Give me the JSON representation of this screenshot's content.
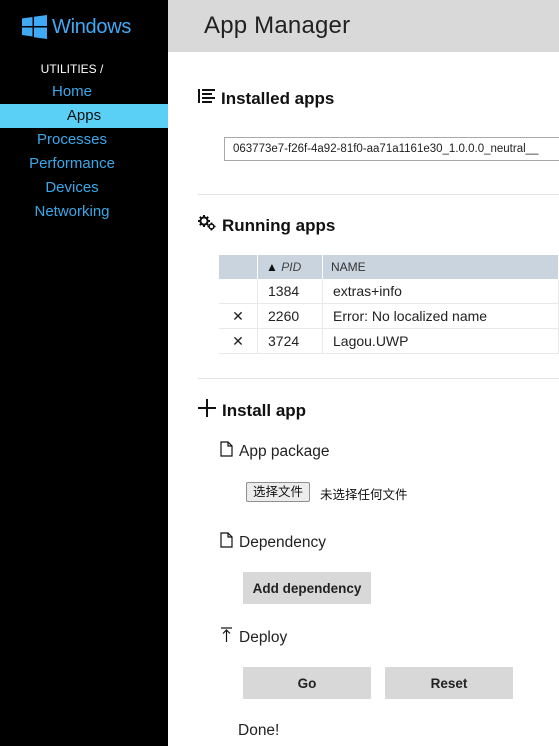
{
  "brand": {
    "logo_text": "Windows",
    "accent": "#3fa9f5"
  },
  "sidebar": {
    "section": "UTILITIES /",
    "items": [
      {
        "label": "Home",
        "active": false
      },
      {
        "label": "Apps",
        "active": true
      },
      {
        "label": "Processes",
        "active": false
      },
      {
        "label": "Performance",
        "active": false
      },
      {
        "label": "Devices",
        "active": false
      },
      {
        "label": "Networking",
        "active": false
      }
    ]
  },
  "header": {
    "title": "App Manager"
  },
  "installed": {
    "title": "Installed apps",
    "selected_app": "063773e7-f26f-4a92-81f0-aa71a1161e30_1.0.0.0_neutral__"
  },
  "running": {
    "title": "Running apps",
    "columns": {
      "sort_indicator": "▲",
      "pid": "PID",
      "name": "NAME"
    },
    "rows": [
      {
        "close": "",
        "pid": "1384",
        "name": "extras+info"
      },
      {
        "close": "✕",
        "pid": "2260",
        "name": "Error: No localized name"
      },
      {
        "close": "✕",
        "pid": "3724",
        "name": "Lagou.UWP"
      }
    ]
  },
  "install": {
    "title": "Install app",
    "package_label": "App package",
    "file_button": "选择文件",
    "file_status": "未选择任何文件",
    "dependency_label": "Dependency",
    "add_dependency_button": "Add dependency",
    "deploy_label": "Deploy",
    "go_button": "Go",
    "reset_button": "Reset",
    "status": "Done!"
  }
}
